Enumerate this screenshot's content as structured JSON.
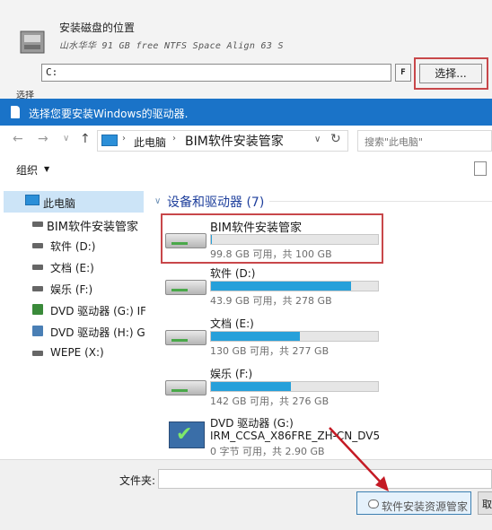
{
  "installer": {
    "title": "安装磁盘的位置",
    "disk_info": "山水华华 91 GB free NTFS Space Align 63 S",
    "path_value": "C:",
    "f_label": "F",
    "choose_label": "选择..."
  },
  "cut_label": "选择",
  "dialog": {
    "title": "选择您要安装Windows的驱动器."
  },
  "address": {
    "pc": "此电脑",
    "folder": "BIM软件安装管家",
    "search_placeholder": "搜索\"此电脑\""
  },
  "toolbar": {
    "organize": "组织"
  },
  "nav": {
    "root": "此电脑",
    "items": [
      "BIM软件安装管家",
      "软件 (D:)",
      "文档 (E:)",
      "娱乐 (F:)",
      "DVD 驱动器 (G:) IF",
      "DVD 驱动器 (H:) G",
      "WEPE (X:)"
    ]
  },
  "group_header": "设备和驱动器 (7)",
  "drives": [
    {
      "name": "BIM软件安装管家",
      "free": "99.8 GB 可用，共 100 GB",
      "used_fraction": 0.002
    },
    {
      "name": "软件 (D:)",
      "free": "43.9 GB 可用，共 278 GB",
      "used_fraction": 0.84
    },
    {
      "name": "文档 (E:)",
      "free": "130 GB 可用，共 277 GB",
      "used_fraction": 0.53
    },
    {
      "name": "娱乐 (F:)",
      "free": "142 GB 可用，共 276 GB",
      "used_fraction": 0.48
    }
  ],
  "dvd": {
    "name": "DVD 驱动器 (G:)",
    "label": "IRM_CCSA_X86FRE_ZH-CN_DV5",
    "free": "0 字节 可用，共 2.90 GB"
  },
  "bottom": {
    "folder_label": "文件夹:",
    "cancel_label": "取"
  },
  "watermark": "软件安装资源管家",
  "colors": {
    "titlebar": "#1a73c8",
    "usage_bar": "#26a0da",
    "highlight": "#c8474a",
    "group_header": "#1e3f9c"
  }
}
